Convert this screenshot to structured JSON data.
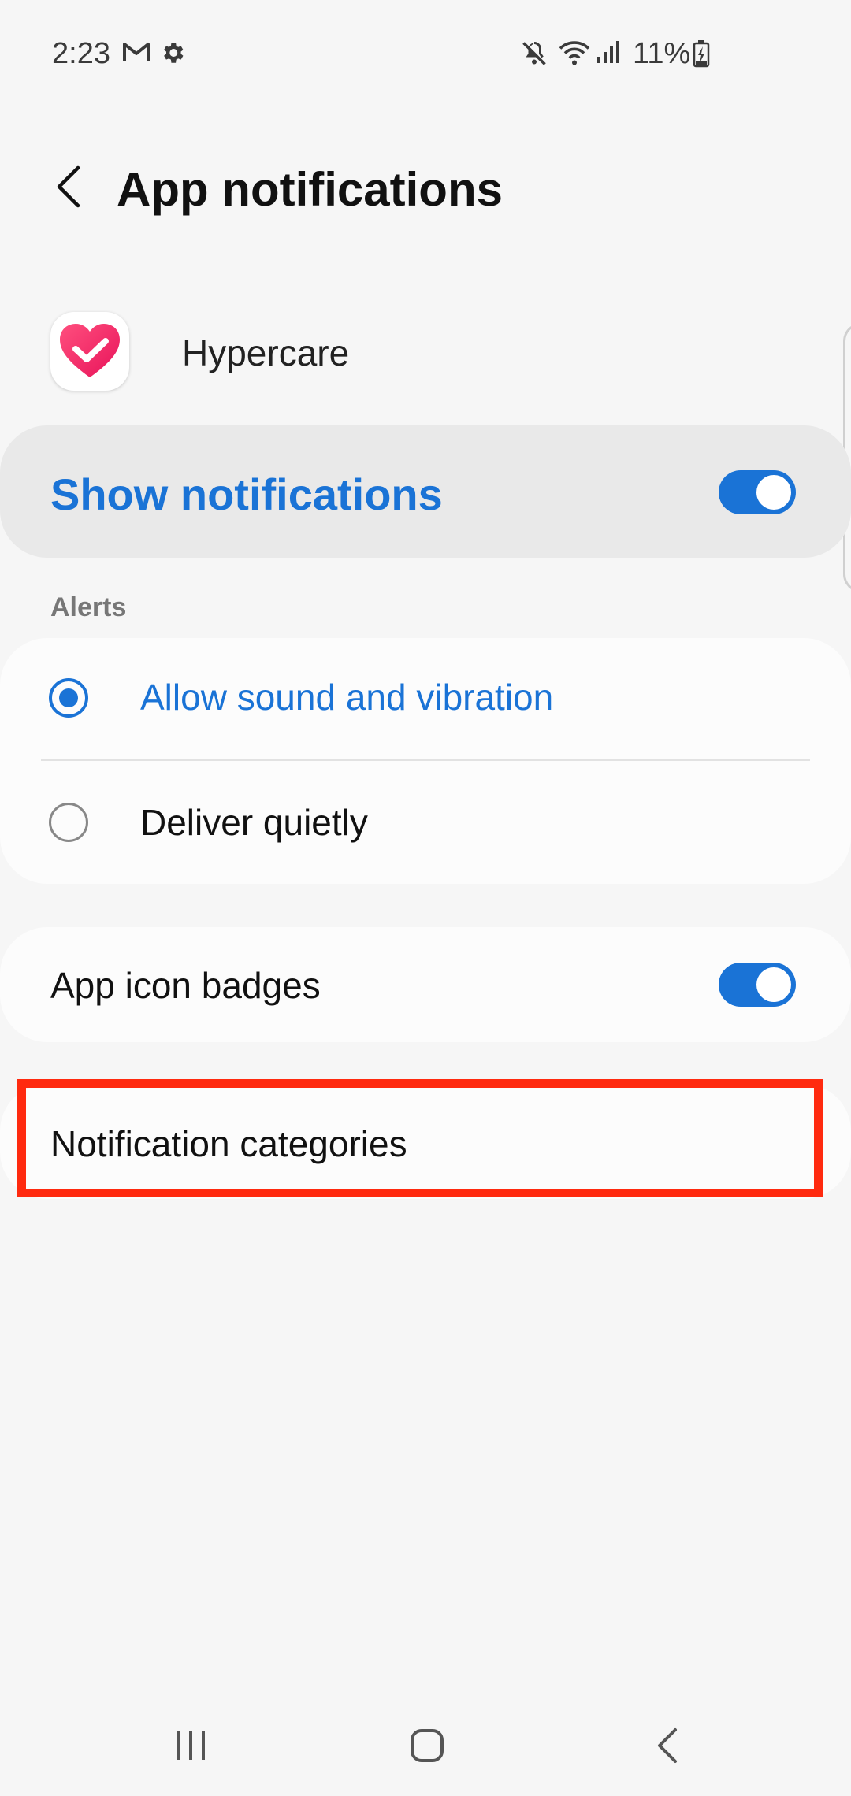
{
  "status_bar": {
    "time": "2:23",
    "battery_percent": "11%",
    "icons": [
      "gmail-icon",
      "settings-icon",
      "mute-icon",
      "wifi-icon",
      "signal-icon",
      "battery-charging-icon"
    ]
  },
  "header": {
    "title": "App notifications",
    "back_icon": "chevron-left-icon"
  },
  "app": {
    "name": "Hypercare",
    "icon": "heart-check-icon"
  },
  "show_notifications": {
    "label": "Show notifications",
    "enabled": true
  },
  "alerts": {
    "header": "Alerts",
    "options": [
      {
        "label": "Allow sound and vibration",
        "selected": true
      },
      {
        "label": "Deliver quietly",
        "selected": false
      }
    ]
  },
  "badges": {
    "label": "App icon badges",
    "enabled": true
  },
  "categories": {
    "label": "Notification categories"
  },
  "nav_bar": {
    "icons": [
      "recents-icon",
      "home-icon",
      "back-icon"
    ]
  },
  "colors": {
    "accent": "#1a73d6",
    "highlight": "#ff2a0f",
    "background": "#f6f6f6",
    "card": "#fcfcfc"
  }
}
